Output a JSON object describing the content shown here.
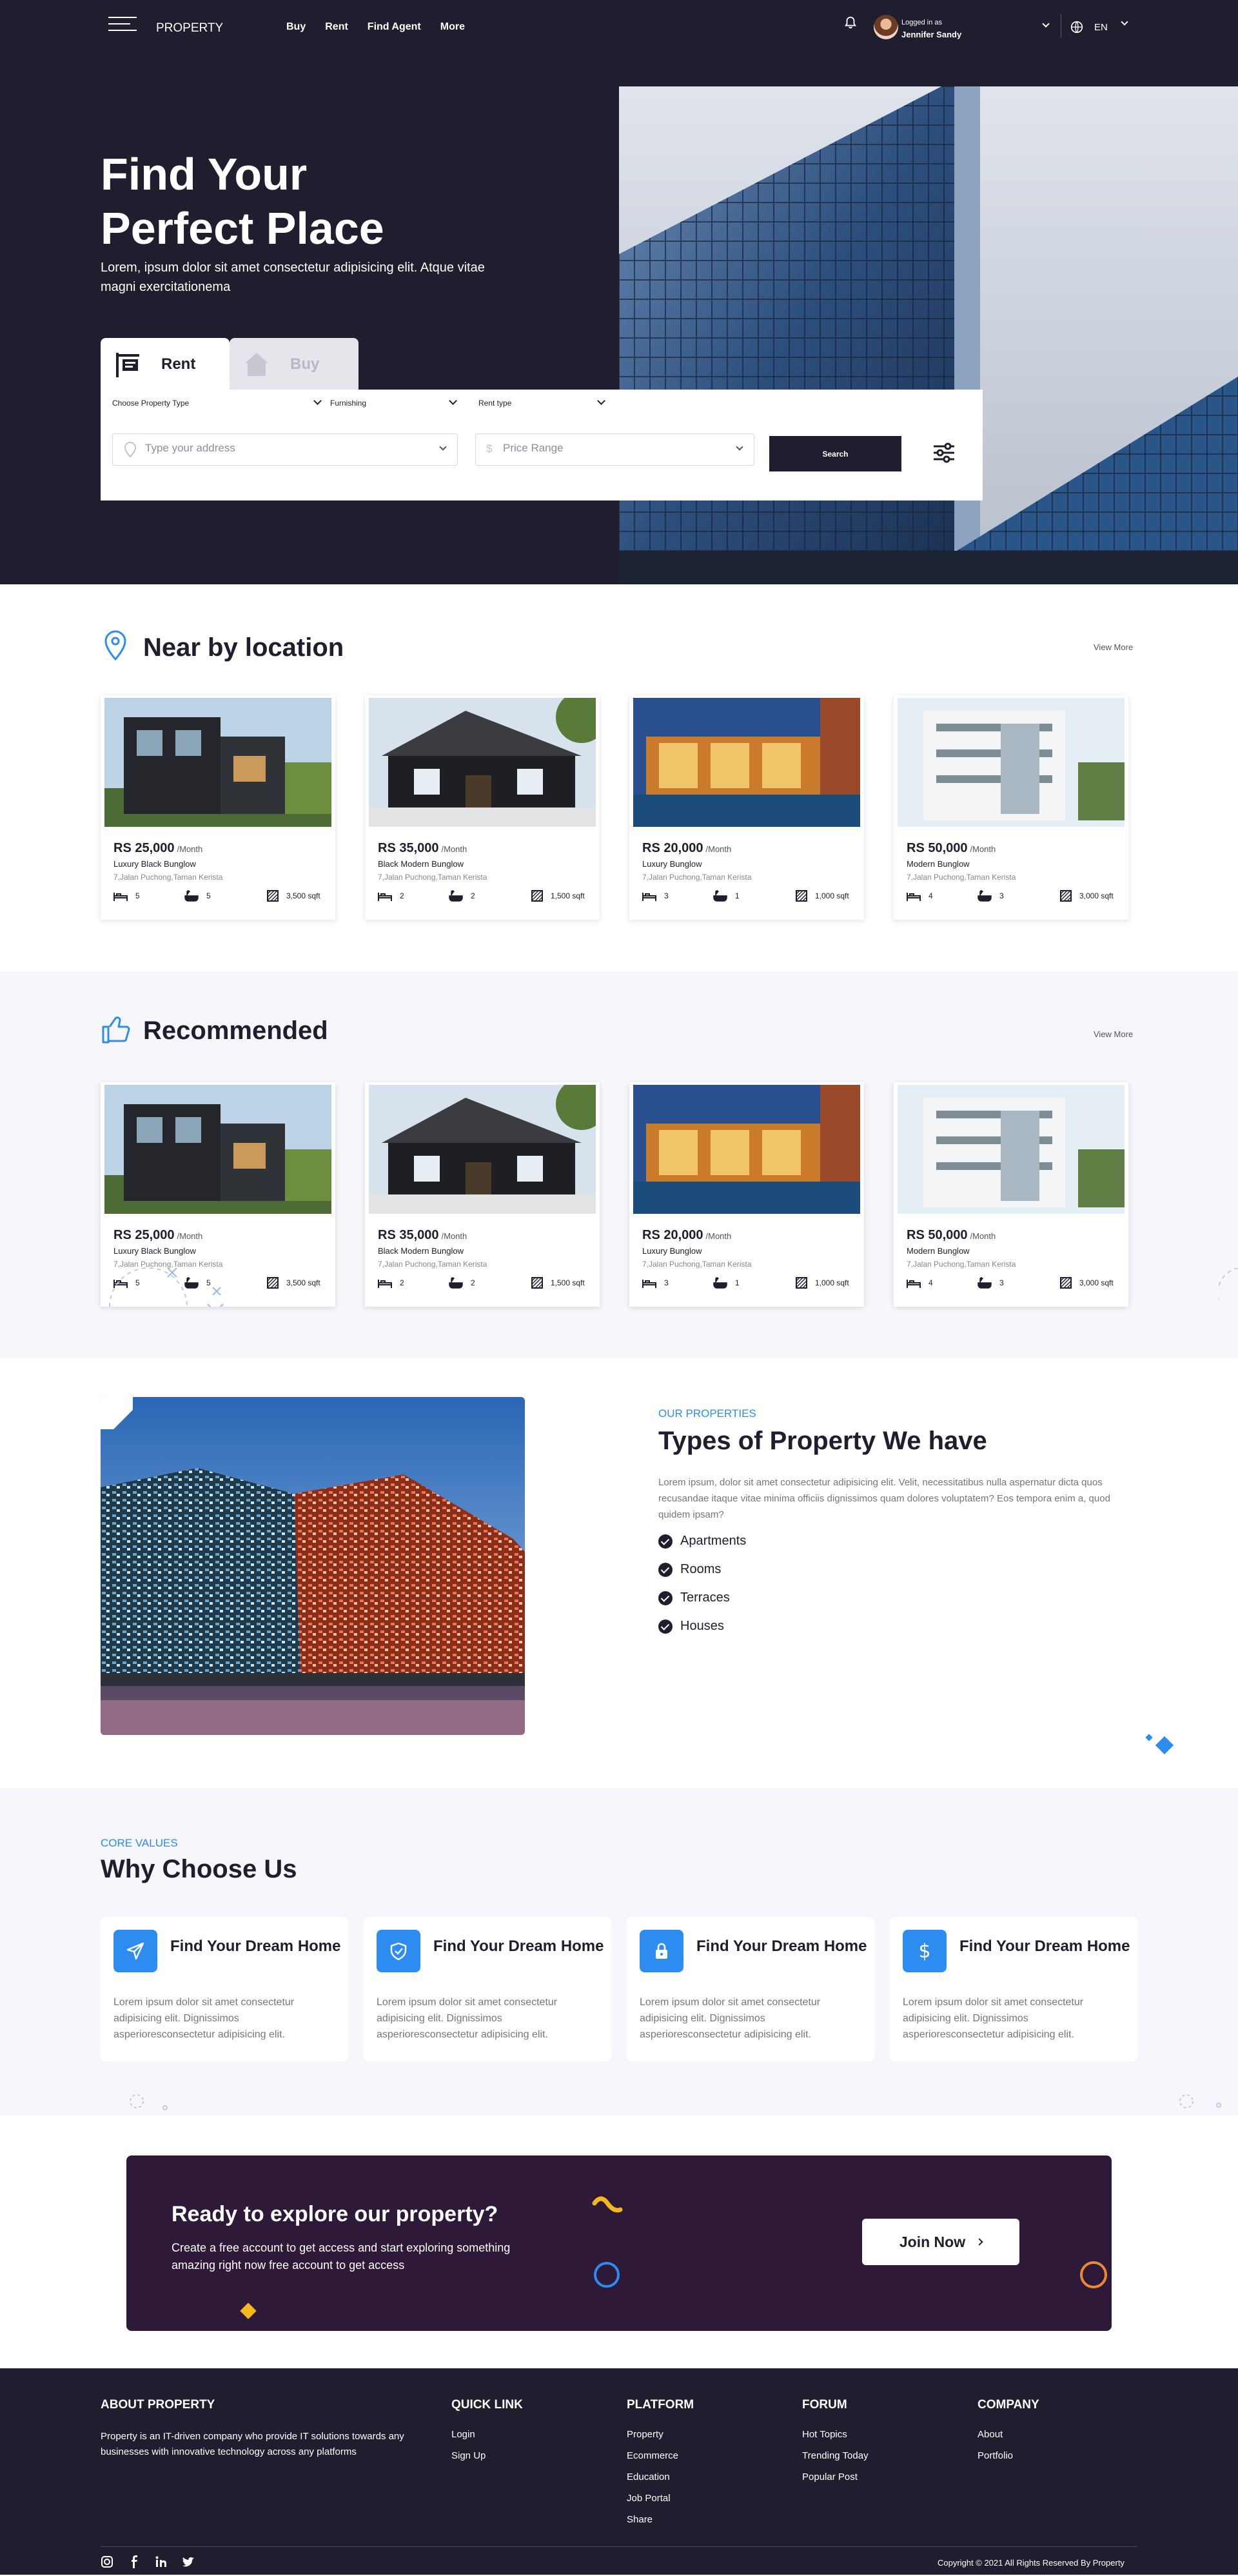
{
  "header": {
    "brand": "PROPERTY",
    "nav": [
      "Buy",
      "Rent",
      "Find Agent",
      "More"
    ],
    "user_caption": "Logged in as",
    "user_name": "Jennifer Sandy",
    "language": "EN"
  },
  "hero": {
    "title_line1": "Find Your",
    "title_line2": "Perfect Place",
    "subtitle": "Lorem, ipsum dolor sit amet consectetur adipisicing elit. Atque vitae magni exercitationema",
    "tabs": [
      {
        "label": "Rent",
        "active": true
      },
      {
        "label": "Buy",
        "active": false
      }
    ],
    "filters": {
      "property_type": "Choose Property Type",
      "furnishing": "Furnishing",
      "rent_type": "Rent type",
      "address_placeholder": "Type your address",
      "price_placeholder": "Price Range",
      "search_label": "Search"
    }
  },
  "nearby": {
    "title": "Near by location",
    "view_more": "View More",
    "cards": [
      {
        "price": "RS 25,000",
        "period": "/Month",
        "name": "Luxury Black Bunglow",
        "address": "7,Jalan Puchong,Taman Kerista",
        "beds": "5",
        "baths": "5",
        "area": "3,500 sqft"
      },
      {
        "price": "RS 35,000",
        "period": "/Month",
        "name": "Black Modern Bunglow",
        "address": "7,Jalan Puchong,Taman Kerista",
        "beds": "2",
        "baths": "2",
        "area": "1,500 sqft"
      },
      {
        "price": "RS 20,000",
        "period": "/Month",
        "name": "Luxury Bunglow",
        "address": "7,Jalan Puchong,Taman Kerista",
        "beds": "3",
        "baths": "1",
        "area": "1,000 sqft"
      },
      {
        "price": "RS 50,000",
        "period": "/Month",
        "name": "Modern Bunglow",
        "address": "7,Jalan Puchong,Taman Kerista",
        "beds": "4",
        "baths": "3",
        "area": "3,000 sqft"
      }
    ]
  },
  "recommended": {
    "title": "Recommended",
    "view_more": "View More",
    "cards": [
      {
        "price": "RS 25,000",
        "period": "/Month",
        "name": "Luxury Black Bunglow",
        "address": "7,Jalan Puchong,Taman Kerista",
        "beds": "5",
        "baths": "5",
        "area": "3,500 sqft"
      },
      {
        "price": "RS 35,000",
        "period": "/Month",
        "name": "Black Modern Bunglow",
        "address": "7,Jalan Puchong,Taman Kerista",
        "beds": "2",
        "baths": "2",
        "area": "1,500 sqft"
      },
      {
        "price": "RS 20,000",
        "period": "/Month",
        "name": "Luxury Bunglow",
        "address": "7,Jalan Puchong,Taman Kerista",
        "beds": "3",
        "baths": "1",
        "area": "1,000 sqft"
      },
      {
        "price": "RS 50,000",
        "period": "/Month",
        "name": "Modern Bunglow",
        "address": "7,Jalan Puchong,Taman Kerista",
        "beds": "4",
        "baths": "3",
        "area": "3,000 sqft"
      }
    ]
  },
  "types": {
    "eyebrow": "OUR PROPERTIES",
    "title": "Types of Property We have",
    "text": "Lorem ipsum, dolor sit amet consectetur adipisicing elit. Velit, necessitatibus nulla aspernatur dicta quos recusandae itaque vitae minima officiis dignissimos quam dolores voluptatem? Eos tempora enim a, quod quidem ipsam?",
    "items": [
      "Apartments",
      "Rooms",
      "Terraces",
      "Houses"
    ]
  },
  "why": {
    "eyebrow": "CORE VALUES",
    "title": "Why Choose Us",
    "cards": [
      {
        "title": "Find Your Dream Home",
        "text": "Lorem ipsum dolor sit amet consectetur adipisicing elit. Dignissimos asperioresconsectetur adipisicing elit.",
        "icon": "send-icon"
      },
      {
        "title": "Find Your Dream Home",
        "text": "Lorem ipsum dolor sit amet consectetur adipisicing elit. Dignissimos asperioresconsectetur adipisicing elit.",
        "icon": "shield-icon"
      },
      {
        "title": "Find Your Dream Home",
        "text": "Lorem ipsum dolor sit amet consectetur adipisicing elit. Dignissimos asperioresconsectetur adipisicing elit.",
        "icon": "lock-icon"
      },
      {
        "title": "Find Your Dream Home",
        "text": "Lorem ipsum dolor sit amet consectetur adipisicing elit. Dignissimos asperioresconsectetur adipisicing elit.",
        "icon": "dollar-icon"
      }
    ]
  },
  "cta": {
    "title": "Ready to explore our property?",
    "text": "Create a free account to get access and start exploring something amazing right now free account to get access",
    "button": "Join Now"
  },
  "footer": {
    "about_title": "ABOUT PROPERTY",
    "about_text": "Property is an IT-driven company who provide IT solutions towards any businesses with innovative technology across any platforms",
    "columns": [
      {
        "title": "QUICK LINK",
        "links": [
          "Login",
          "Sign Up"
        ]
      },
      {
        "title": "PLATFORM",
        "links": [
          "Property",
          "Ecommerce",
          "Education",
          "Job Portal",
          "Share"
        ]
      },
      {
        "title": "FORUM",
        "links": [
          "Hot Topics",
          "Trending Today",
          "Popular Post"
        ]
      },
      {
        "title": "COMPANY",
        "links": [
          "About",
          "Portfolio"
        ]
      }
    ],
    "copyright": "Copyright © 2021 All Rights Reserved By Property"
  },
  "colors": {
    "dark": "#1f1e2e",
    "accent": "#2d8cf0",
    "cta_bg": "#2e1a38",
    "soft_bg": "#f7f6fb"
  }
}
